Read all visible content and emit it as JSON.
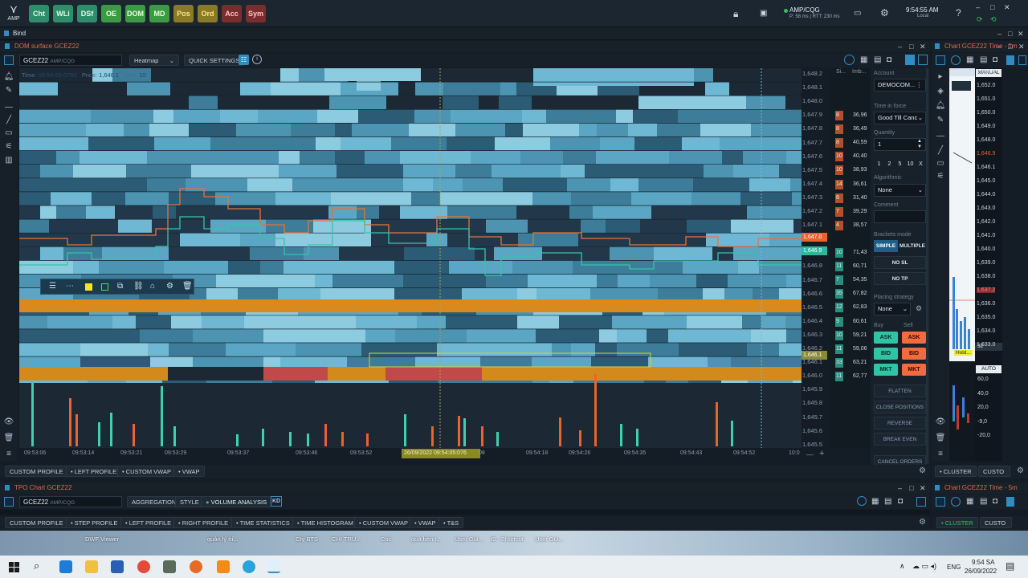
{
  "topbar": {
    "logo": "AMP",
    "buttons": [
      {
        "label": "Cht",
        "bg": "#2f8d6a",
        "fg": "#dff9ee"
      },
      {
        "label": "WLi",
        "bg": "#2f8d6a",
        "fg": "#dff9ee"
      },
      {
        "label": "DSf",
        "bg": "#2f8d6a",
        "fg": "#dff9ee"
      },
      {
        "label": "OE",
        "bg": "#3d9a44",
        "fg": "#e9ffe0"
      },
      {
        "label": "DOM",
        "bg": "#3d9a44",
        "fg": "#e9ffe0"
      },
      {
        "label": "MD",
        "bg": "#3d9a44",
        "fg": "#e9ffe0"
      },
      {
        "label": "Pos",
        "bg": "#8a7a26",
        "fg": "#ffe48a"
      },
      {
        "label": "Ord",
        "bg": "#8a7a26",
        "fg": "#ffe48a"
      },
      {
        "label": "Acc",
        "bg": "#7b2d2d",
        "fg": "#ffc7c7"
      },
      {
        "label": "Sym",
        "bg": "#7b2d2d",
        "fg": "#ffc7c7"
      }
    ],
    "connection": "AMP/CQG",
    "latency": "P: 58 ms | RTT: 230 ms",
    "clock": "9:54:55 AM",
    "clock_zone": "Local"
  },
  "bind": {
    "label": "Bind"
  },
  "dom_panel": {
    "title": "DOM surface GCEZ22",
    "symbol": "GCEZ22",
    "exchange": "AMP/CQG",
    "mode": "Heatmap",
    "quick_settings": "QUICK SETTINGS",
    "info": {
      "time_label": "Time:",
      "time": "09:54:05:0760",
      "price_label": "Price:",
      "price": "1,646.1",
      "size_label": "Size:",
      "size": "10"
    },
    "price_axis": [
      "1,648.2",
      "1,648.1",
      "1,648.0",
      "1,647.9",
      "1,647.8",
      "1,647.7",
      "1,647.6",
      "1,647.5",
      "1,647.4",
      "1,647.3",
      "1,647.2",
      "1,647.1",
      "1,647.0",
      "1,646.9",
      "1,646.8",
      "1,646.7",
      "1,646.6",
      "1,646.5",
      "1,646.4",
      "1,646.3",
      "1,646.2",
      "1,646.1",
      "1,646.0",
      "1,645.9",
      "1,645.8",
      "1,645.7",
      "1,645.6",
      "1,645.5"
    ],
    "ask_marker": "1,647.0",
    "bid_marker": "1,646.9",
    "cursor_marker": "1,646.1",
    "time_axis": [
      "09:53:06",
      "09:53:14",
      "09:53:21",
      "09:53:29",
      "09:53:37",
      "09:53:46",
      "09:53:52",
      "09:54:18",
      "09:54:26",
      "09:54:35",
      "09:54:43",
      "09:54:52"
    ],
    "cursor_time": "26/09/2022 09:54:05:076",
    "cursor_time_suffix": "08",
    "zoom_label": "10:0",
    "dom_headers": [
      "Si...",
      "Imb..."
    ],
    "dom_rows": [
      {
        "size": "8",
        "imb": "36,96",
        "side": "ask"
      },
      {
        "size": "8",
        "imb": "36,49",
        "side": "ask"
      },
      {
        "size": "8",
        "imb": "40,59",
        "side": "ask"
      },
      {
        "size": "10",
        "imb": "40,40",
        "side": "ask"
      },
      {
        "size": "10",
        "imb": "38,93",
        "side": "ask"
      },
      {
        "size": "14",
        "imb": "36,61",
        "side": "ask"
      },
      {
        "size": "8",
        "imb": "31,40",
        "side": "ask"
      },
      {
        "size": "7",
        "imb": "39,29",
        "side": "ask"
      },
      {
        "size": "4",
        "imb": "38,57",
        "side": "ask"
      },
      {
        "size": "",
        "imb": "",
        "side": "none"
      },
      {
        "size": "10",
        "imb": "71,43",
        "side": "bid"
      },
      {
        "size": "11",
        "imb": "60,71",
        "side": "bid"
      },
      {
        "size": "7",
        "imb": "54,35",
        "side": "bid"
      },
      {
        "size": "35",
        "imb": "67,82",
        "side": "bid"
      },
      {
        "size": "12",
        "imb": "62,83",
        "side": "bid"
      },
      {
        "size": "9",
        "imb": "60,61",
        "side": "bid"
      },
      {
        "size": "10",
        "imb": "59,21",
        "side": "bid"
      },
      {
        "size": "11",
        "imb": "59,06",
        "side": "bid"
      },
      {
        "size": "33",
        "imb": "63,21",
        "side": "bid"
      },
      {
        "size": "11",
        "imb": "62,77",
        "side": "bid"
      }
    ],
    "bottom_tabs": [
      "CUSTOM PROFILE",
      "LEFT PROFILE",
      "CUSTOM VWAP",
      "VWAP"
    ]
  },
  "order_panel": {
    "account_label": "Account",
    "account": "DEMOCOM...",
    "tif_label": "Time in force",
    "tif": "Good Till Canc",
    "qty_label": "Quantity",
    "qty": "1",
    "qty_presets": [
      "1",
      "2",
      "5",
      "10",
      "X"
    ],
    "algo_label": "Algorithmic",
    "algo": "None",
    "comment_label": "Comment",
    "brackets_label": "Brackets mode",
    "simple": "SIMPLE",
    "multiple": "MULTIPLE",
    "no_sl": "NO SL",
    "no_tp": "NO TP",
    "placing_label": "Placing strategy",
    "placing": "None",
    "buy_label": "Buy",
    "sell_label": "Sell",
    "ask": "ASK",
    "bid": "BID",
    "mkt": "MKT",
    "actions": [
      "FLATTEN",
      "CLOSE POSITIONS",
      "REVERSE",
      "BREAK EVEN",
      "CANCEL ORDERS"
    ],
    "buy_color": "#2fc4a6",
    "sell_color": "#f26a3d"
  },
  "chart_panel": {
    "title": "Chart GCEZ22 Time - 1m",
    "mode": "MANUAL",
    "auto": "AUTO",
    "hold": "Hold...",
    "label_32": "32",
    "axis": [
      "1,653.0",
      "1,652.0",
      "1,651.0",
      "1,650.0",
      "1,649.0",
      "1,648.0",
      "1,646.9",
      "1,646.1",
      "1,645.0",
      "1,644.0",
      "1,643.0",
      "1,642.0",
      "1,641.0",
      "1,640.0",
      "1,639.0",
      "1,638.0",
      "1,637.2",
      "1,636.0",
      "1,635.0",
      "1,634.0",
      "1,633.0"
    ],
    "lower_axis": [
      "60,0",
      "40,0",
      "20,0",
      "-9,0",
      "-20,0"
    ],
    "tabs": [
      "CLUSTER",
      "CUSTO"
    ]
  },
  "tpo_panel": {
    "title": "TPO Chart GCEZ22",
    "symbol": "GCEZ22",
    "exchange": "AMP/CQG",
    "tools": [
      "AGGREGATION",
      "STYLE",
      "VOLUME ANALYSIS"
    ],
    "tabs": [
      "CUSTOM PROFILE",
      "STEP PROFILE",
      "LEFT PROFILE",
      "RIGHT PROFILE",
      "TIME STATISTICS",
      "TIME HISTOGRAM",
      "CUSTOM VWAP",
      "VWAP",
      "T&S"
    ]
  },
  "chart5_panel": {
    "title": "Chart GCEZ22 Time - 5m",
    "tabs": [
      "CLUSTER",
      "CUSTO"
    ]
  },
  "desktop": {
    "labels": [
      "DWF Viewer",
      "quản lý hi...",
      "Cty BTS",
      "CHI TRU...",
      "Cóc",
      "quả bèn t...",
      "User Gui...",
      "t9 - Shortcut",
      "User Gui..."
    ]
  },
  "taskbar": {
    "lang": "ENG",
    "time": "9:54 SA",
    "date": "26/09/2022"
  }
}
